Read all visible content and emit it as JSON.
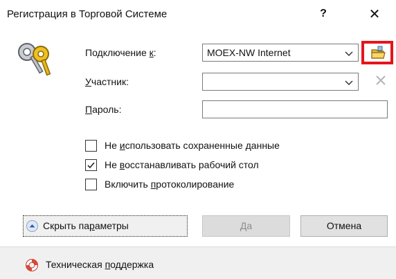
{
  "window": {
    "title": "Регистрация в Торговой Системе",
    "help_label": "?",
    "close_glyph": "✕"
  },
  "icons": {
    "keys": "keys-icon",
    "open_folder": "open-folder-icon",
    "clear": "close-icon",
    "chevron": "chevron-down-icon",
    "lifebuoy": "lifebuoy-icon",
    "collapse": "chevron-up-circle-icon"
  },
  "form": {
    "connection": {
      "label_pre": "Подключение ",
      "label_key": "к",
      "label_post": ":",
      "value": "MOEX-NW Internet"
    },
    "participant": {
      "label_key": "У",
      "label_post": "частник:",
      "value": ""
    },
    "password": {
      "label_key": "П",
      "label_post": "ароль:",
      "value": ""
    }
  },
  "options": [
    {
      "pre": "Не ",
      "key": "и",
      "post": "спользовать сохраненные данные",
      "checked": false
    },
    {
      "pre": "Не ",
      "key": "в",
      "post": "осстанавливать рабочий стол",
      "checked": true
    },
    {
      "pre": "Включить ",
      "key": "п",
      "post": "ротоколирование",
      "checked": false
    }
  ],
  "buttons": {
    "toggle_pre": "Скрыть па",
    "toggle_key": "р",
    "toggle_post": "аметры",
    "ok": "Да",
    "cancel": "Отмена"
  },
  "footer": {
    "support_pre": "Техническая ",
    "support_key": "п",
    "support_post": "оддержка"
  },
  "colors": {
    "highlight_border": "#e5141c",
    "footer_bg": "#f0f0f0"
  }
}
